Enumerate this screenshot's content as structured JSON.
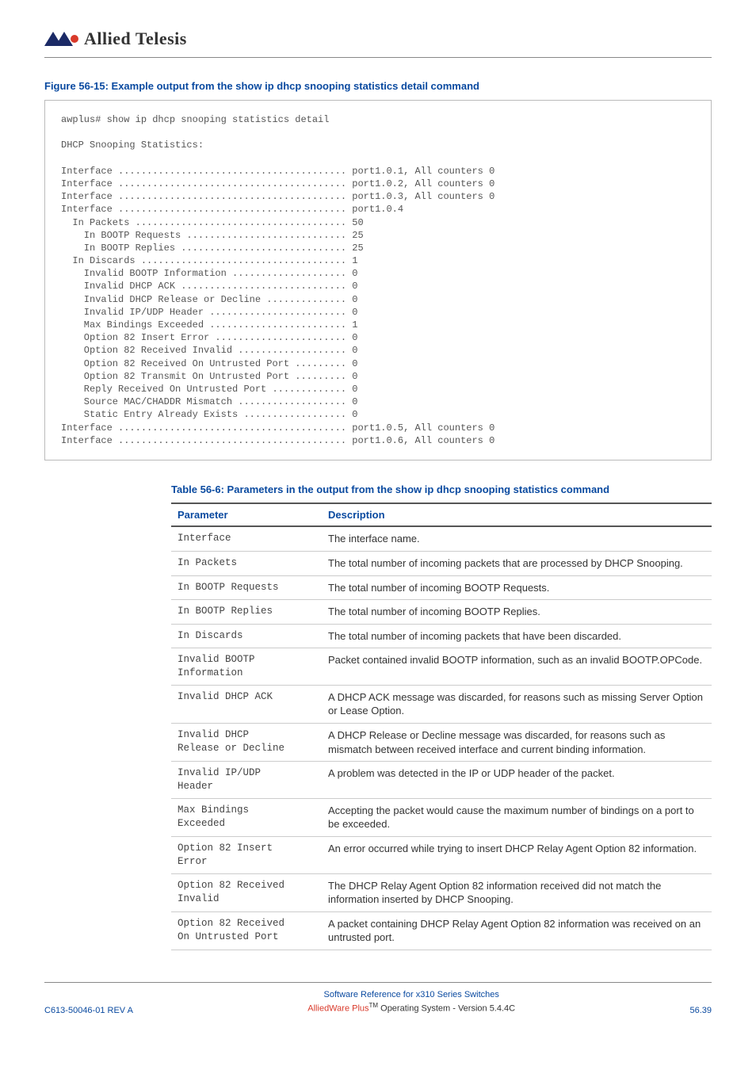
{
  "logo": {
    "text": "Allied Telesis"
  },
  "figure": {
    "title": "Figure 56-15: Example output from the show ip dhcp snooping statistics detail command"
  },
  "cli": {
    "command": "awplus# show ip dhcp snooping statistics detail",
    "header": "DHCP Snooping Statistics:",
    "output": "Interface ........................................ port1.0.1, All counters 0\nInterface ........................................ port1.0.2, All counters 0\nInterface ........................................ port1.0.3, All counters 0\nInterface ........................................ port1.0.4\n  In Packets ..................................... 50\n    In BOOTP Requests ............................ 25\n    In BOOTP Replies ............................. 25\n  In Discards .................................... 1\n    Invalid BOOTP Information .................... 0\n    Invalid DHCP ACK ............................. 0\n    Invalid DHCP Release or Decline .............. 0\n    Invalid IP/UDP Header ........................ 0\n    Max Bindings Exceeded ........................ 1\n    Option 82 Insert Error ....................... 0\n    Option 82 Received Invalid ................... 0\n    Option 82 Received On Untrusted Port ......... 0\n    Option 82 Transmit On Untrusted Port ......... 0\n    Reply Received On Untrusted Port ............. 0\n    Source MAC/CHADDR Mismatch ................... 0\n    Static Entry Already Exists .................. 0\nInterface ........................................ port1.0.5, All counters 0\nInterface ........................................ port1.0.6, All counters 0"
  },
  "table": {
    "title": "Table 56-6: Parameters in the output from the show ip dhcp snooping statistics command",
    "headers": {
      "param": "Parameter",
      "desc": "Description"
    },
    "rows": [
      {
        "param": "Interface",
        "desc": "The interface name."
      },
      {
        "param": "In Packets",
        "desc": "The total number of incoming packets that are processed by DHCP Snooping."
      },
      {
        "param": "In BOOTP Requests",
        "desc": "The total number of incoming BOOTP Requests."
      },
      {
        "param": "In BOOTP Replies",
        "desc": "The total number of incoming BOOTP Replies."
      },
      {
        "param": "In Discards",
        "desc": "The total number of incoming packets that have been discarded."
      },
      {
        "param": "Invalid BOOTP\nInformation",
        "desc": "Packet contained invalid BOOTP information, such as an invalid BOOTP.OPCode."
      },
      {
        "param": "Invalid DHCP ACK",
        "desc": "A DHCP ACK message was discarded, for reasons such as missing Server Option or Lease Option."
      },
      {
        "param": "Invalid DHCP\nRelease or Decline",
        "desc": "A DHCP Release or Decline message was discarded, for reasons such as mismatch between received interface and current binding information."
      },
      {
        "param": "Invalid IP/UDP\nHeader",
        "desc": "A problem was detected in the IP or UDP header of the packet."
      },
      {
        "param": "Max Bindings\nExceeded",
        "desc": "Accepting the packet would cause the maximum number of bindings on a port to be exceeded."
      },
      {
        "param": "Option 82 Insert\nError",
        "desc": "An error occurred while trying to insert DHCP Relay Agent Option 82 information."
      },
      {
        "param": "Option 82 Received\nInvalid",
        "desc": "The DHCP Relay Agent Option 82 information received did not match the information inserted by DHCP Snooping."
      },
      {
        "param": "Option 82 Received\nOn Untrusted Port",
        "desc": "A packet containing DHCP Relay Agent Option 82 information was received on an untrusted port."
      }
    ]
  },
  "footer": {
    "left": "C613-50046-01 REV A",
    "center_line1": "Software Reference for x310 Series Switches",
    "center_line2a": "AlliedWare Plus",
    "center_line2b": " Operating System - Version 5.4.4C",
    "right": "56.39"
  }
}
